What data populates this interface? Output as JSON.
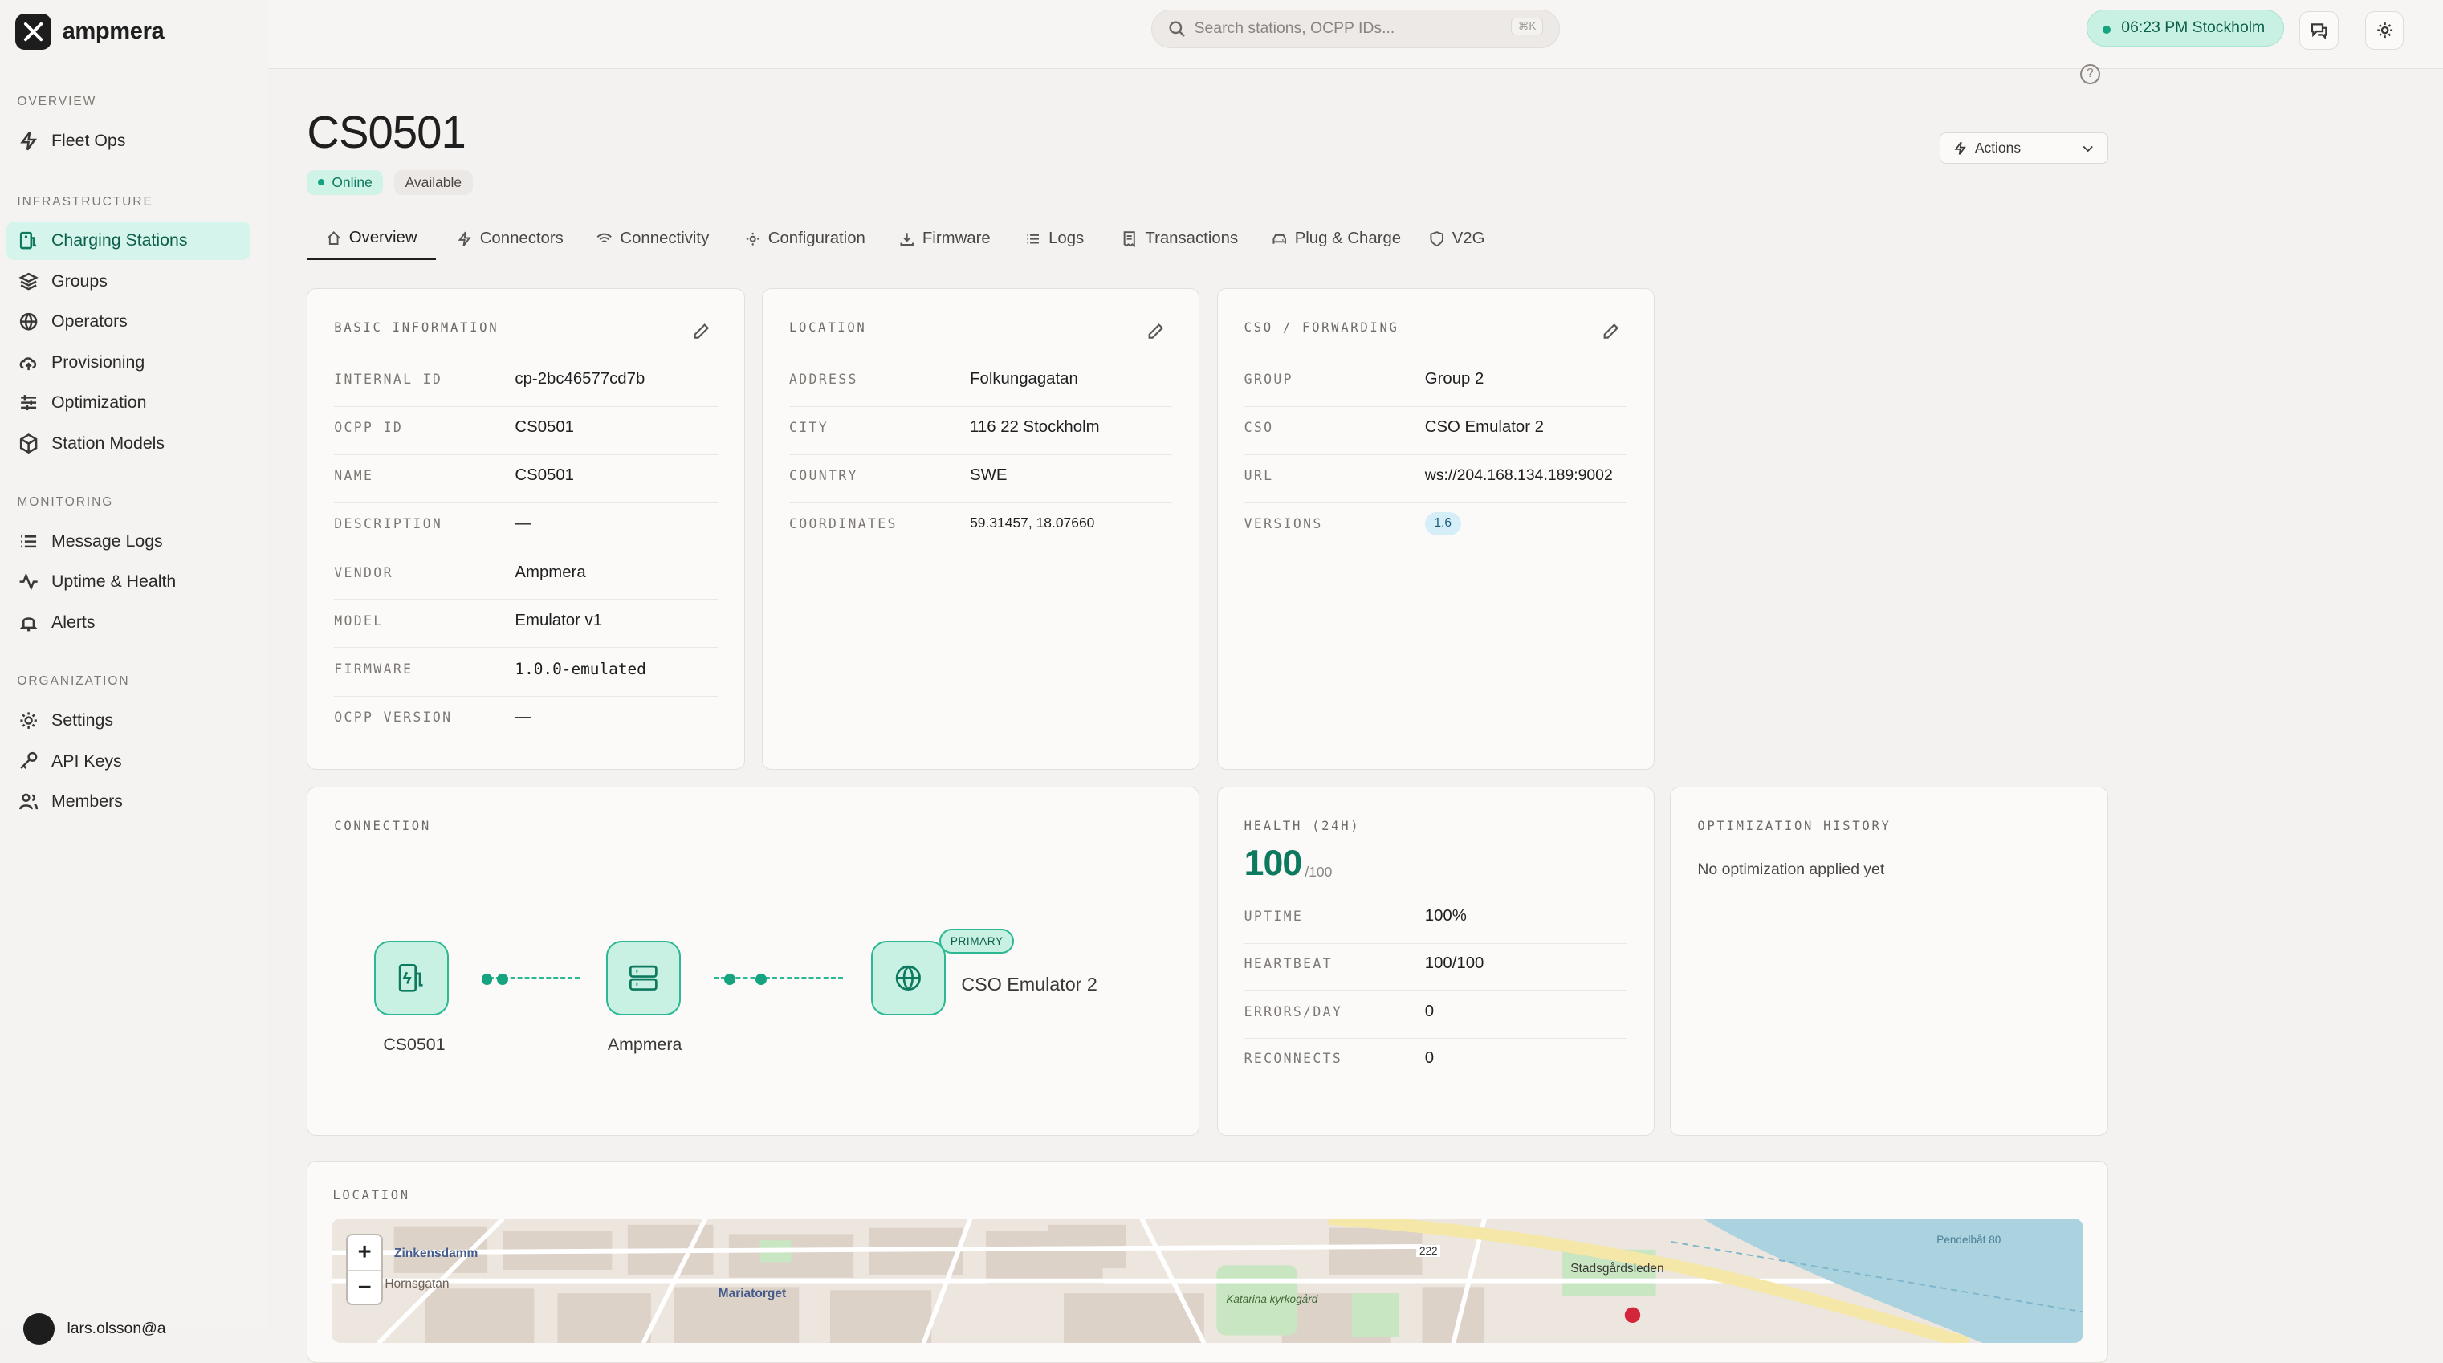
{
  "brand": {
    "name": "ampmera"
  },
  "sidebar": {
    "sections": [
      {
        "title": "OVERVIEW",
        "items": [
          {
            "label": "Fleet Ops",
            "icon": "bolt-icon"
          }
        ]
      },
      {
        "title": "INFRASTRUCTURE",
        "items": [
          {
            "label": "Charging Stations",
            "icon": "charger-icon",
            "active": true
          },
          {
            "label": "Groups",
            "icon": "layers-icon"
          },
          {
            "label": "Operators",
            "icon": "globe-icon"
          },
          {
            "label": "Provisioning",
            "icon": "cloud-upload-icon"
          },
          {
            "label": "Optimization",
            "icon": "sliders-icon"
          },
          {
            "label": "Station Models",
            "icon": "cube-icon"
          }
        ]
      },
      {
        "title": "MONITORING",
        "items": [
          {
            "label": "Message Logs",
            "icon": "list-icon"
          },
          {
            "label": "Uptime & Health",
            "icon": "activity-icon"
          },
          {
            "label": "Alerts",
            "icon": "bell-icon"
          }
        ]
      },
      {
        "title": "ORGANIZATION",
        "items": [
          {
            "label": "Settings",
            "icon": "gear-icon"
          },
          {
            "label": "API Keys",
            "icon": "key-icon"
          },
          {
            "label": "Members",
            "icon": "users-icon"
          }
        ]
      }
    ],
    "user": {
      "label": "lars.olsson@a"
    }
  },
  "topbar": {
    "search_placeholder": "Search stations, OCPP IDs...",
    "search_shortcut": "⌘K",
    "clock": "06:23 PM Stockholm"
  },
  "station": {
    "title": "CS0501",
    "status_online": "Online",
    "status_available": "Available",
    "actions_label": "Actions"
  },
  "tabs": [
    {
      "label": "Overview",
      "icon": "home-icon",
      "active": true
    },
    {
      "label": "Connectors",
      "icon": "bolt-icon"
    },
    {
      "label": "Connectivity",
      "icon": "wifi-icon"
    },
    {
      "label": "Configuration",
      "icon": "gear-icon"
    },
    {
      "label": "Firmware",
      "icon": "download-icon"
    },
    {
      "label": "Logs",
      "icon": "list-icon"
    },
    {
      "label": "Transactions",
      "icon": "receipt-icon"
    },
    {
      "label": "Plug & Charge",
      "icon": "car-icon"
    },
    {
      "label": "V2G",
      "icon": "shield-icon"
    }
  ],
  "basic_info": {
    "title": "BASIC INFORMATION",
    "rows": [
      {
        "key": "INTERNAL ID",
        "value": "cp-2bc46577cd7b"
      },
      {
        "key": "OCPP ID",
        "value": "CS0501"
      },
      {
        "key": "NAME",
        "value": "CS0501"
      },
      {
        "key": "DESCRIPTION",
        "value": "—"
      },
      {
        "key": "VENDOR",
        "value": "Ampmera"
      },
      {
        "key": "MODEL",
        "value": "Emulator v1"
      },
      {
        "key": "FIRMWARE",
        "value": "1.0.0-emulated"
      },
      {
        "key": "OCPP VERSION",
        "value": "—"
      }
    ]
  },
  "location_card": {
    "title": "LOCATION",
    "rows": [
      {
        "key": "ADDRESS",
        "value": "Folkungagatan"
      },
      {
        "key": "CITY",
        "value": "116 22 Stockholm"
      },
      {
        "key": "COUNTRY",
        "value": "SWE"
      },
      {
        "key": "COORDINATES",
        "value": "59.31457, 18.07660"
      }
    ]
  },
  "cso_card": {
    "title": "CSO / FORWARDING",
    "rows": [
      {
        "key": "GROUP",
        "value": "Group 2"
      },
      {
        "key": "CSO",
        "value": "CSO Emulator 2"
      },
      {
        "key": "URL",
        "value": "ws://204.168.134.189:9002"
      },
      {
        "key": "VERSIONS",
        "value": "1.6"
      }
    ]
  },
  "connection": {
    "title": "CONNECTION",
    "station_label": "CS0501",
    "hub_label": "Ampmera",
    "cso_label": "CSO Emulator 2",
    "primary_tag": "PRIMARY"
  },
  "health": {
    "title": "HEALTH (24H)",
    "score": "100",
    "score_max": "/100",
    "rows": [
      {
        "key": "UPTIME",
        "value": "100%"
      },
      {
        "key": "HEARTBEAT",
        "value": "100/100"
      },
      {
        "key": "ERRORS/DAY",
        "value": "0"
      },
      {
        "key": "RECONNECTS",
        "value": "0"
      }
    ]
  },
  "optimization": {
    "title": "OPTIMIZATION HISTORY",
    "empty_text": "No optimization applied yet"
  },
  "map_section": {
    "title": "LOCATION",
    "zoom_in": "+",
    "zoom_out": "−",
    "labels": [
      "Zinkensdamm",
      "Hornsgatan",
      "Mariatorget",
      "Katarina kyrkogård",
      "Stadsgårdsleden",
      "222",
      "Pendelbåt 80"
    ]
  },
  "colors": {
    "accent": "#16a37f",
    "accent_light": "#c9f1e3",
    "background": "#f4f2f0"
  }
}
